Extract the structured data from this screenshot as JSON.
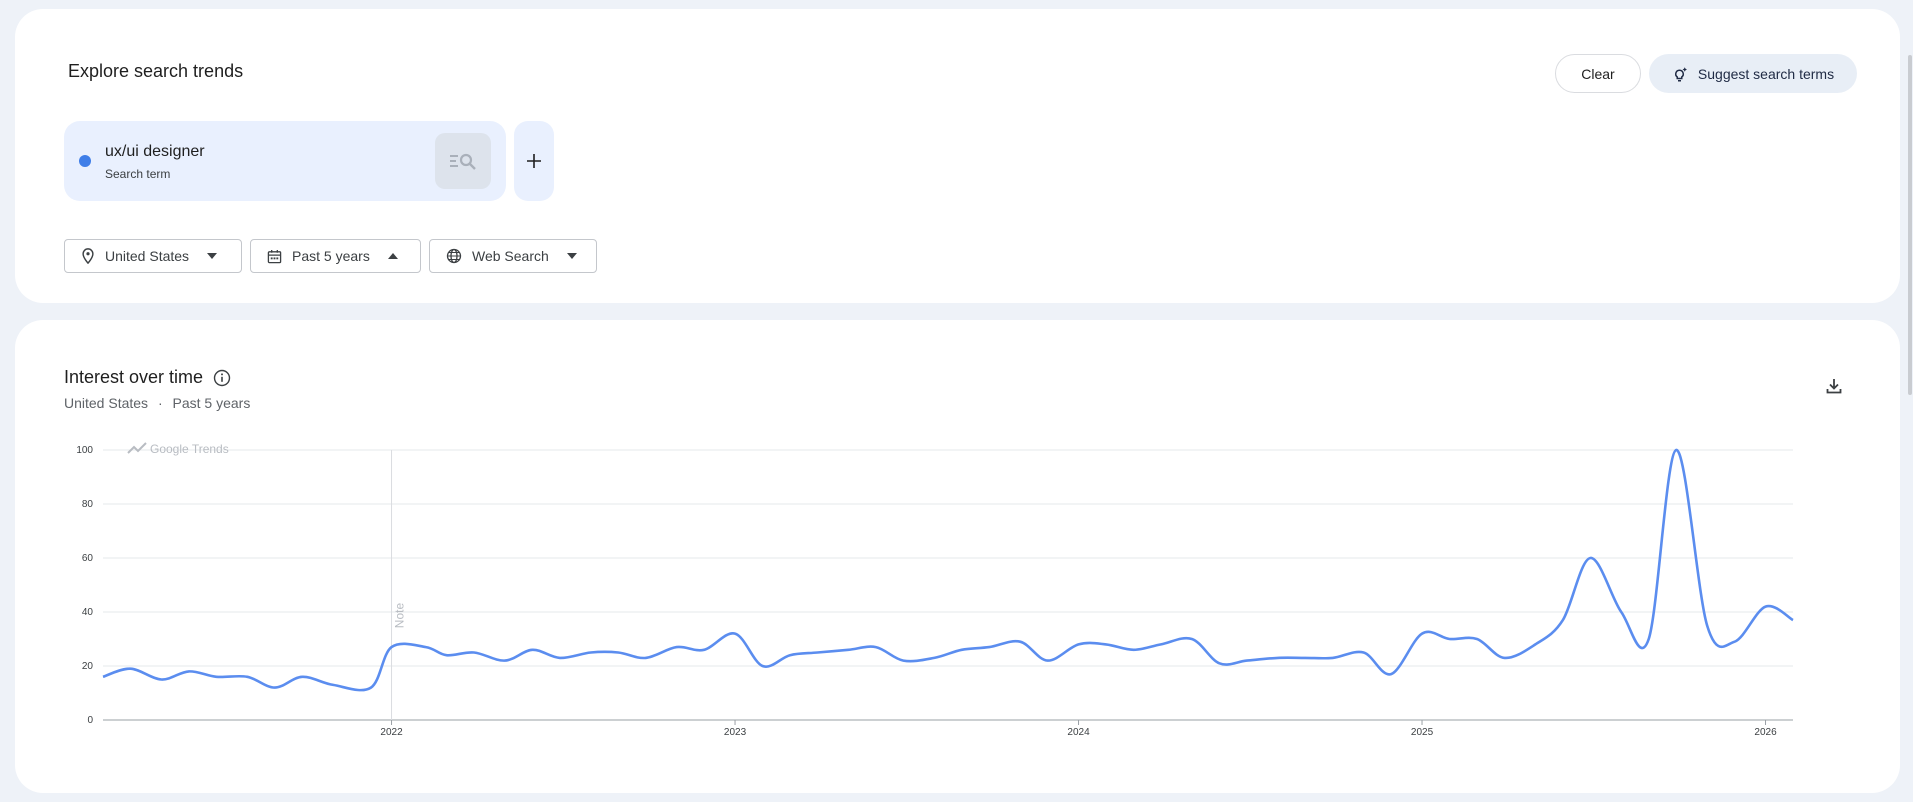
{
  "explore": {
    "title": "Explore search trends",
    "clear_label": "Clear",
    "suggest_label": "Suggest search terms"
  },
  "terms": [
    {
      "name": "ux/ui designer",
      "type_label": "Search term",
      "color": "#3f7ee8"
    }
  ],
  "filters": {
    "geo": "United States",
    "time": "Past 5 years",
    "property": "Web Search"
  },
  "interest": {
    "title": "Interest over time",
    "subtitle_geo": "United States",
    "subtitle_sep": "·",
    "subtitle_time": "Past 5 years",
    "watermark": "Google Trends",
    "note_label": "Note"
  },
  "colors": {
    "series": "#5b8def",
    "chip_bg": "#e9f0fe",
    "page_bg": "#eef2f8"
  },
  "chart_data": {
    "type": "line",
    "ylim": [
      0,
      100
    ],
    "yticks": [
      0,
      20,
      40,
      60,
      80,
      100
    ],
    "xlim": [
      2021.16,
      2026.08
    ],
    "xticks": [
      {
        "value": 2022,
        "label": "2022"
      },
      {
        "value": 2023,
        "label": "2023"
      },
      {
        "value": 2024,
        "label": "2024"
      },
      {
        "value": 2025,
        "label": "2025"
      },
      {
        "value": 2026,
        "label": "2026"
      }
    ],
    "note_at": 2022,
    "grid": true,
    "series": [
      {
        "color": "#5b8def",
        "points": [
          [
            2021.16,
            16
          ],
          [
            2021.24,
            19
          ],
          [
            2021.33,
            15
          ],
          [
            2021.41,
            18
          ],
          [
            2021.49,
            16
          ],
          [
            2021.58,
            16
          ],
          [
            2021.66,
            12
          ],
          [
            2021.74,
            16
          ],
          [
            2021.83,
            13
          ],
          [
            2021.94,
            12
          ],
          [
            2022.0,
            27
          ],
          [
            2022.1,
            27
          ],
          [
            2022.16,
            24
          ],
          [
            2022.24,
            25
          ],
          [
            2022.33,
            22
          ],
          [
            2022.41,
            26
          ],
          [
            2022.49,
            23
          ],
          [
            2022.58,
            25
          ],
          [
            2022.66,
            25
          ],
          [
            2022.74,
            23
          ],
          [
            2022.83,
            27
          ],
          [
            2022.91,
            26
          ],
          [
            2023.0,
            32
          ],
          [
            2023.08,
            20
          ],
          [
            2023.16,
            24
          ],
          [
            2023.24,
            25
          ],
          [
            2023.33,
            26
          ],
          [
            2023.41,
            27
          ],
          [
            2023.49,
            22
          ],
          [
            2023.58,
            23
          ],
          [
            2023.66,
            26
          ],
          [
            2023.74,
            27
          ],
          [
            2023.83,
            29
          ],
          [
            2023.91,
            22
          ],
          [
            2024.0,
            28
          ],
          [
            2024.08,
            28
          ],
          [
            2024.16,
            26
          ],
          [
            2024.24,
            28
          ],
          [
            2024.33,
            30
          ],
          [
            2024.41,
            21
          ],
          [
            2024.49,
            22
          ],
          [
            2024.58,
            23
          ],
          [
            2024.66,
            23
          ],
          [
            2024.74,
            23
          ],
          [
            2024.83,
            25
          ],
          [
            2024.91,
            17
          ],
          [
            2025.0,
            32
          ],
          [
            2025.08,
            30
          ],
          [
            2025.16,
            30
          ],
          [
            2025.24,
            23
          ],
          [
            2025.33,
            28
          ],
          [
            2025.41,
            37
          ],
          [
            2025.49,
            60
          ],
          [
            2025.58,
            40
          ],
          [
            2025.66,
            30
          ],
          [
            2025.74,
            100
          ],
          [
            2025.83,
            35
          ],
          [
            2025.91,
            29
          ],
          [
            2026.0,
            42
          ],
          [
            2026.08,
            37
          ]
        ]
      }
    ]
  }
}
